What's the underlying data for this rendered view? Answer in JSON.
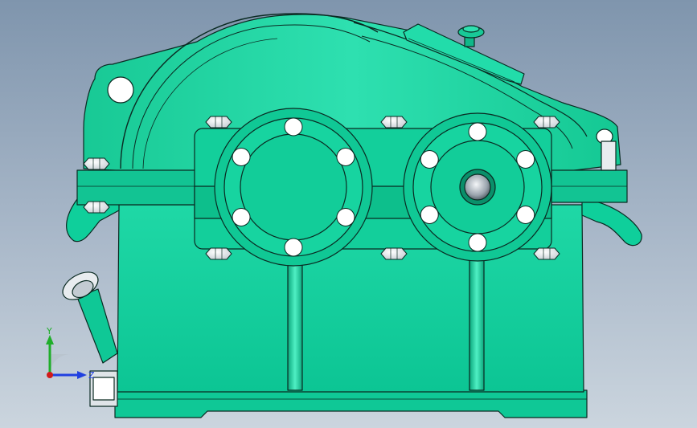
{
  "viewport": {
    "background_top": "#7f95ad",
    "background_bottom": "#cbd5de"
  },
  "model": {
    "name": "",
    "body_color": "#0fcd9a",
    "body_dark": "#0a9a73",
    "body_light": "#3fe3b6",
    "edge_color": "#0a2a22",
    "bolt_color": "#e8ecef"
  },
  "triad": {
    "x_label": "",
    "y_label": "Y",
    "z_label": "Z",
    "x_color": "#d11a1a",
    "y_color": "#1fae2a",
    "z_color": "#2040e0"
  }
}
